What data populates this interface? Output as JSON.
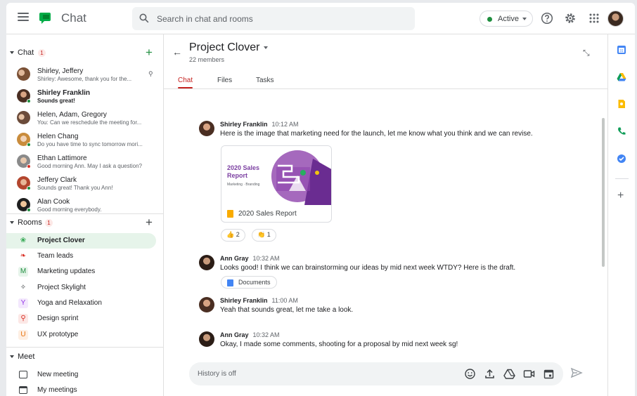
{
  "app": {
    "title": "Chat"
  },
  "search": {
    "placeholder": "Search in chat and rooms"
  },
  "status": {
    "label": "Active"
  },
  "sidebar": {
    "chat_section": {
      "label": "Chat",
      "badge": "1"
    },
    "dms": [
      {
        "name": "Shirley, Jeffery",
        "snippet": "Shirley: Awesome, thank you for the...",
        "bold": false
      },
      {
        "name": "Shirley Franklin",
        "snippet": "Sounds great!",
        "bold": true
      },
      {
        "name": "Helen, Adam, Gregory",
        "snippet": "You: Can we reschedule the meeting for...",
        "bold": false
      },
      {
        "name": "Helen Chang",
        "snippet": "Do you have time to sync tomorrow mori...",
        "bold": false
      },
      {
        "name": "Ethan Lattimore",
        "snippet": "Good morning Ann. May I ask a question?",
        "bold": false
      },
      {
        "name": "Jeffery Clark",
        "snippet": "Sounds great! Thank you Ann!",
        "bold": false
      },
      {
        "name": "Alan Cook",
        "snippet": "Good morning everybody.",
        "bold": false
      }
    ],
    "rooms_section": {
      "label": "Rooms",
      "badge": "1"
    },
    "rooms": [
      {
        "label": "Project Clover",
        "icon": "clover-icon",
        "glyph": "❀",
        "color": "#34a853",
        "selected": true
      },
      {
        "label": "Team leads",
        "icon": "leaf-icon",
        "glyph": "❧",
        "color": "#d93025",
        "selected": false
      },
      {
        "label": "Marketing updates",
        "icon": "letter-m-icon",
        "glyph": "M",
        "color": "#1e8e3e",
        "selected": false
      },
      {
        "label": "Project Skylight",
        "icon": "figure-icon",
        "glyph": "✧",
        "color": "#3c4043",
        "selected": false
      },
      {
        "label": "Yoga and Relaxation",
        "icon": "letter-y-icon",
        "glyph": "Y",
        "color": "#9334e6",
        "selected": false
      },
      {
        "label": "Design sprint",
        "icon": "search-icon",
        "glyph": "⚲",
        "color": "#d93025",
        "selected": false
      },
      {
        "label": "UX prototype",
        "icon": "letter-u-icon",
        "glyph": "U",
        "color": "#e8710a",
        "selected": false
      }
    ],
    "meet_section": {
      "label": "Meet"
    },
    "meet_items": [
      {
        "label": "New meeting",
        "icon": "new-meeting-icon"
      },
      {
        "label": "My meetings",
        "icon": "calendar-icon"
      }
    ]
  },
  "room": {
    "title": "Project Clover",
    "members": "22 members",
    "tabs": [
      "Chat",
      "Files",
      "Tasks"
    ]
  },
  "messages": [
    {
      "author": "Shirley Franklin",
      "time": "10:12 AM",
      "text": "Here is the image that marketing need for the launch, let me know what you think and we can revise."
    },
    {
      "author": "Ann Gray",
      "time": "10:32 AM",
      "text": "Looks good! I think we can brainstorming our ideas by mid next week WTDY? Here is the draft."
    },
    {
      "author": "Shirley Franklin",
      "time": "11:00 AM",
      "text": "Yeah that sounds great, let me take a look."
    },
    {
      "author": "Ann Gray",
      "time": "10:32 AM",
      "text": "Okay, I made some comments, shooting for a proposal by mid next week sg!"
    }
  ],
  "attachment": {
    "thumb_title": "2020 Sales Report",
    "thumb_sub": "Marketing · Branding",
    "name": "2020 Sales Report"
  },
  "reactions": [
    {
      "emoji": "👍",
      "count": "2"
    },
    {
      "emoji": "👏",
      "count": "1"
    }
  ],
  "documents_chip": {
    "label": "Documents"
  },
  "composer": {
    "placeholder": "History is off"
  },
  "colors": {
    "accent": "#c5221f",
    "selected_room_bg": "#e6f4ea",
    "online": "#1e8e3e"
  }
}
